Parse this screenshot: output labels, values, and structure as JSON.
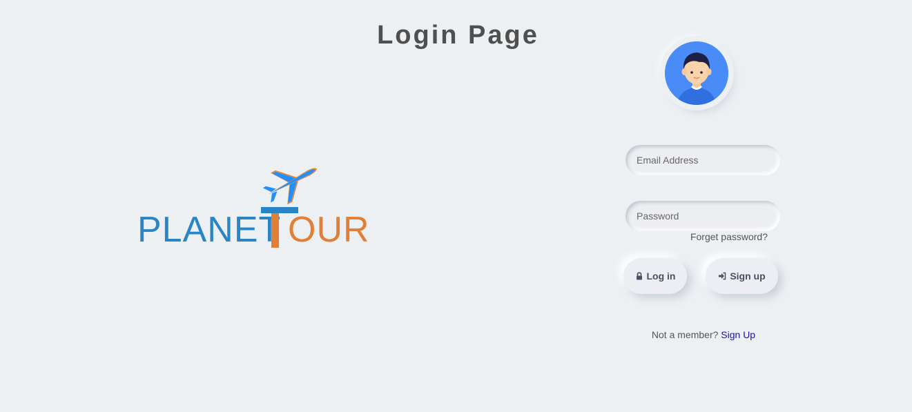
{
  "page": {
    "title": "Login Page"
  },
  "logo": {
    "text_part1": "PLANET",
    "text_part2": "OUR",
    "letter_t": "T",
    "colors": {
      "blue": "#2a85c6",
      "orange": "#e07f35",
      "plane": "#1e90ff"
    },
    "icon": "airplane-icon"
  },
  "avatar": {
    "icon": "user-avatar-icon",
    "background": "#4a8cf7"
  },
  "form": {
    "email": {
      "placeholder": "Email Address",
      "value": ""
    },
    "password": {
      "placeholder": "Password",
      "value": ""
    },
    "forgot_label": "Forget password?",
    "login_label": "Log in",
    "login_icon": "lock-icon",
    "signup_label": "Sign up",
    "signup_icon": "sign-in-icon"
  },
  "footer": {
    "prompt": "Not a member?",
    "link_label": "Sign Up",
    "link_color": "#1a0dab"
  },
  "colors": {
    "background": "#ecf0f3",
    "text": "#555555"
  }
}
